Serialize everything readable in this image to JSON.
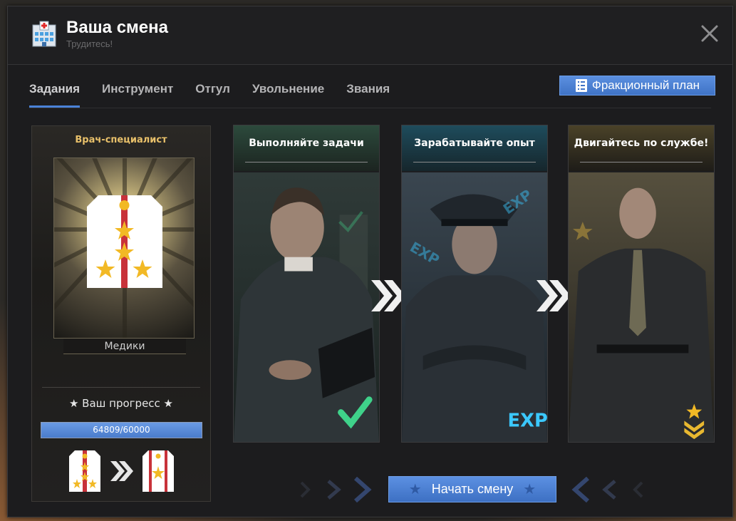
{
  "window": {
    "title": "Ваша смена",
    "subtitle": "Трудитесь!"
  },
  "tabs": [
    {
      "label": "Задания",
      "active": true
    },
    {
      "label": "Инструмент",
      "active": false
    },
    {
      "label": "Отгул",
      "active": false
    },
    {
      "label": "Увольнение",
      "active": false
    },
    {
      "label": "Звания",
      "active": false
    }
  ],
  "faction_plan_button": "Фракционный план",
  "rank": {
    "title": "Врач-специалист",
    "faction": "Медики",
    "progress_label": "★ Ваш прогресс ★",
    "progress_current": 64809,
    "progress_max": 60000,
    "progress_text": "64809/60000"
  },
  "steps": [
    {
      "title": "Выполняйте задачи",
      "badge": "check-icon"
    },
    {
      "title": "Зарабатывайте опыт",
      "badge": "EXP"
    },
    {
      "title": "Двигайтесь по службе!",
      "badge": "rank-chevron-icon"
    }
  ],
  "start_button": "Начать смену",
  "colors": {
    "accent": "#4a82d8",
    "gold": "#e8c06a",
    "check": "#3fd28a",
    "exp": "#3bc8ff",
    "stripe": "#c8323a",
    "star": "#f2b925"
  }
}
